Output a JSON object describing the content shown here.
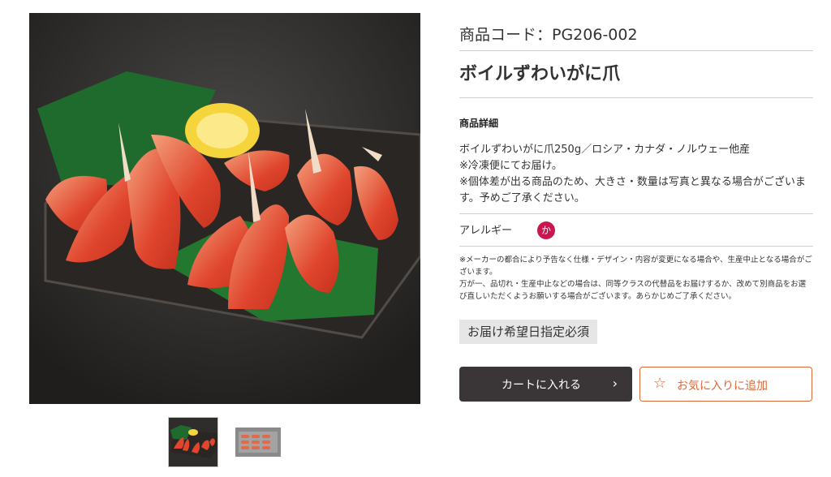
{
  "product": {
    "code_line": "商品コード：PG206-002",
    "name": "ボイルずわいがに爪",
    "detail_label": "商品詳細",
    "description": [
      "ボイルずわいがに爪250g／ロシア・カナダ・ノルウェー他産",
      "※冷凍便にてお届け。",
      "※個体差が出る商品のため、大きさ・数量は写真と異なる場合がございます。予めご了承ください。"
    ],
    "allergy_label": "アレルギー",
    "allergy_badge": "か",
    "notices": [
      "※メーカーの都合により予告なく仕様・デザイン・内容が変更になる場合や、生産中止となる場合がございます。",
      "万が一、品切れ・生産中止などの場合は、同等クラスの代替品をお届けするか、改めて別商品をお選び直しいただくようお願いする場合がございます。あらかじめご了承ください。"
    ],
    "delivery_badge": "お届け希望日指定必須"
  },
  "actions": {
    "cart_label": "カートに入れる",
    "cart_icon": "chevron-right-icon",
    "favorite_label": "お気に入りに追加",
    "favorite_icon": "star-outline-icon"
  },
  "colors": {
    "cart_button": "#3a3638",
    "favorite_accent": "#d86a3a",
    "allergy_badge": "#c8174f",
    "delivery_badge_bg": "#e6e6e6"
  }
}
